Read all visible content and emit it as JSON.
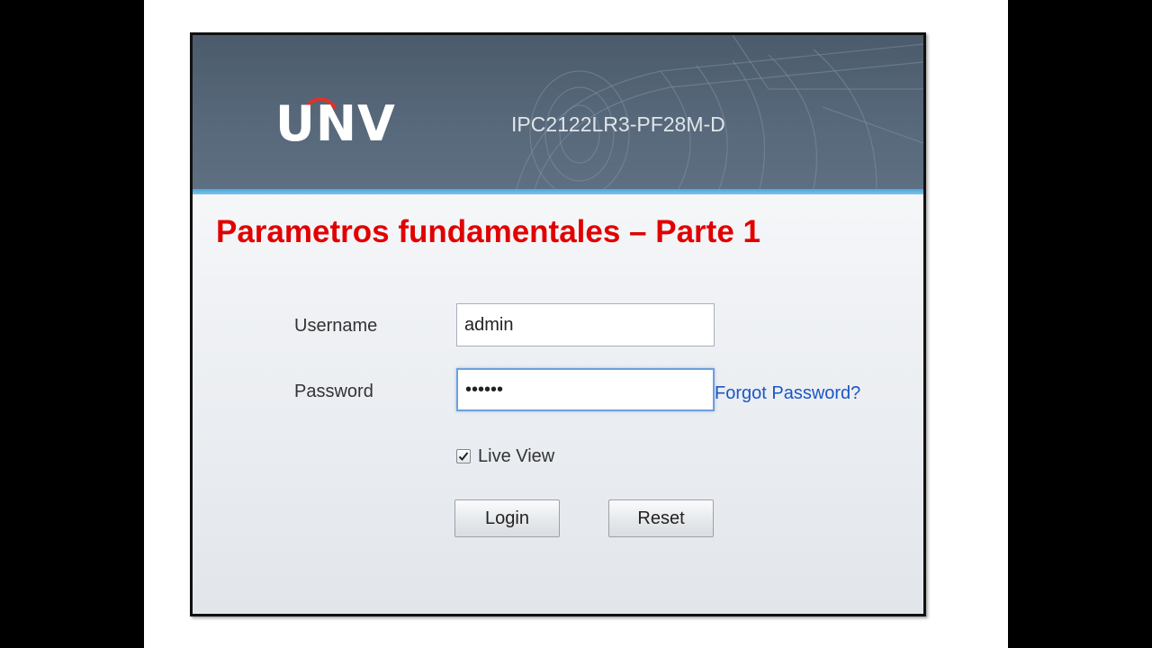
{
  "header": {
    "logo_text": "UNV",
    "model": "IPC2122LR3-PF28M-D"
  },
  "headline": "Parametros fundamentales – Parte 1",
  "form": {
    "username_label": "Username",
    "username_value": "admin",
    "password_label": "Password",
    "password_value": "••••••",
    "forgot_link": "Forgot Password?",
    "live_view_label": "Live View",
    "live_view_checked": true,
    "login_button": "Login",
    "reset_button": "Reset"
  },
  "colors": {
    "banner": "#55667a",
    "accent_stripe": "#4aa6dc",
    "headline": "#e10000",
    "link": "#1a57c4",
    "logo_arc": "#e0312b"
  },
  "icons": {
    "logo_arc": "red-arc",
    "checkbox": "checkmark"
  }
}
